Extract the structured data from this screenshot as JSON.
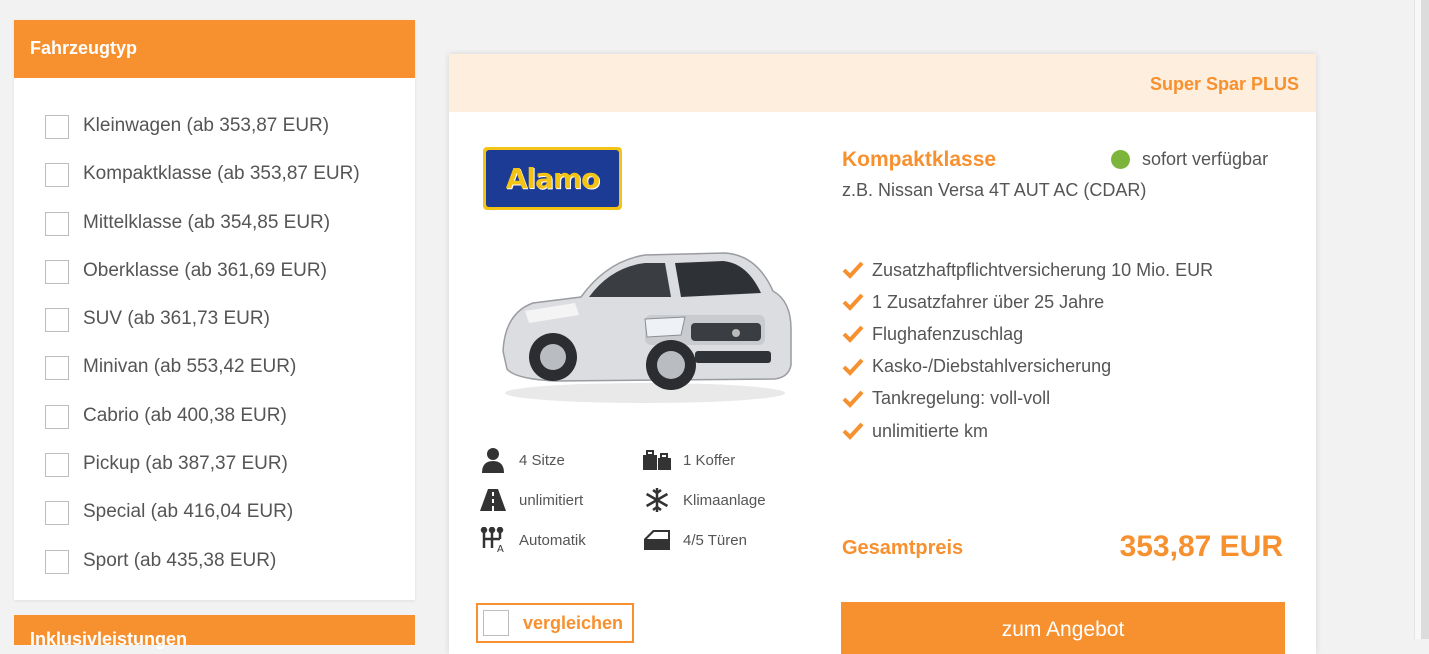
{
  "sidebar": {
    "title": "Fahrzeugtyp",
    "items": [
      {
        "label": "Kleinwagen (ab 353,87 EUR)"
      },
      {
        "label": "Kompaktklasse (ab 353,87 EUR)"
      },
      {
        "label": "Mittelklasse (ab 354,85 EUR)"
      },
      {
        "label": "Oberklasse (ab 361,69 EUR)"
      },
      {
        "label": "SUV (ab 361,73 EUR)"
      },
      {
        "label": "Minivan (ab 553,42 EUR)"
      },
      {
        "label": "Cabrio (ab 400,38 EUR)"
      },
      {
        "label": "Pickup (ab 387,37 EUR)"
      },
      {
        "label": "Special (ab 416,04 EUR)"
      },
      {
        "label": "Sport (ab 435,38 EUR)"
      }
    ],
    "next_section_title": "Inklusivleistungen"
  },
  "offer": {
    "tag": "Super Spar PLUS",
    "provider_logo_text": "Alamo",
    "car_class": "Kompaktklasse",
    "availability": "sofort verfügbar",
    "example": "z.B. Nissan Versa 4T AUT AC (CDAR)",
    "features": {
      "seats": "4 Sitze",
      "luggage": "1 Koffer",
      "mileage": "unlimitiert",
      "ac": "Klimaanlage",
      "transmission": "Automatik",
      "doors": "4/5 Türen"
    },
    "inclusions": [
      "Zusatzhaftpflichtversicherung 10 Mio. EUR",
      "1 Zusatzfahrer über 25 Jahre",
      "Flughafenzuschlag",
      "Kasko-/Diebstahlversicherung",
      "Tankregelung: voll-voll",
      "unlimitierte km"
    ],
    "total_label": "Gesamtpreis",
    "total_price": "353,87 EUR",
    "compare_label": "vergleichen",
    "cta_label": "zum Angebot"
  },
  "colors": {
    "accent": "#f7902e",
    "header_tint": "#fdeedd",
    "available": "#7db53b",
    "logo_blue": "#1b3b95",
    "logo_yellow": "#f3c316"
  },
  "icons": [
    "person-icon",
    "luggage-icon",
    "road-icon",
    "snowflake-icon",
    "gearshift-icon",
    "car-door-icon",
    "checkmark-icon",
    "available-dot-icon"
  ]
}
